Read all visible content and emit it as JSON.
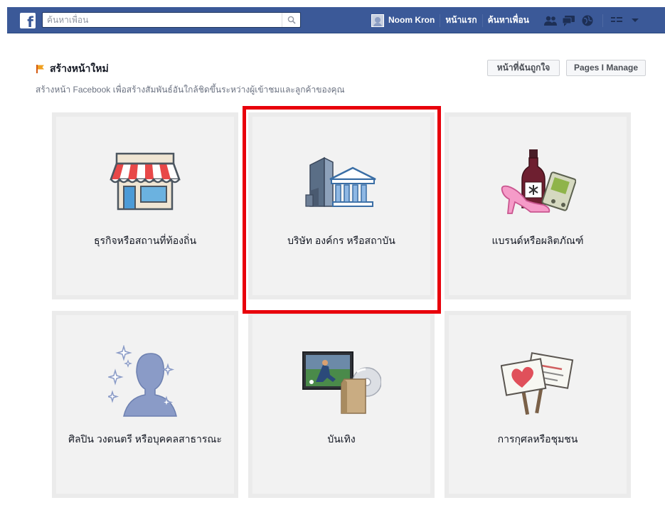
{
  "app": {
    "logo_letter": "f"
  },
  "search": {
    "placeholder": "ค้นหาเพื่อน",
    "value": ""
  },
  "nav": {
    "user_name": "Noom Kron",
    "home": "หน้าแรก",
    "find_friends": "ค้นหาเพื่อน",
    "icons": [
      "friend-requests-icon",
      "messages-icon",
      "notifications-icon",
      "privacy-shortcuts-icon",
      "account-menu-icon"
    ]
  },
  "header": {
    "title": "สร้างหน้าใหม่",
    "subtitle": "สร้างหน้า Facebook เพื่อสร้างสัมพันธ์อันใกล้ชิดขึ้นระหว่างผู้เข้าชมและลูกค้าของคุณ",
    "liked_pages_label": "หน้าที่ฉันถูกใจ",
    "pages_manage_label": "Pages I Manage"
  },
  "categories": [
    {
      "label": "ธุรกิจหรือสถานที่ท้องถิ่น",
      "icon": "storefront-icon"
    },
    {
      "label": "บริษัท องค์กร หรือสถาบัน",
      "icon": "institution-building-icon"
    },
    {
      "label": "แบรนด์หรือผลิตภัณฑ์",
      "icon": "brand-products-icon"
    },
    {
      "label": "ศิลปิน วงดนตรี หรือบุคคลสาธารณะ",
      "icon": "public-figure-icon"
    },
    {
      "label": "บันเทิง",
      "icon": "entertainment-icon"
    },
    {
      "label": "การกุศลหรือชุมชน",
      "icon": "cause-community-icon"
    }
  ],
  "colors": {
    "topbar": "#3b5998",
    "highlight": "#e8000b",
    "tile_bg": "#f2f2f2"
  }
}
